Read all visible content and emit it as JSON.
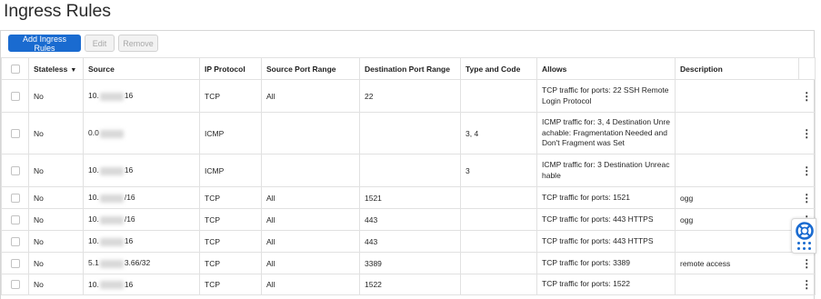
{
  "page": {
    "title": "Ingress Rules"
  },
  "toolbar": {
    "add_label": "Add Ingress Rules",
    "edit_label": "Edit",
    "remove_label": "Remove"
  },
  "table": {
    "headers": {
      "stateless": "Stateless",
      "source": "Source",
      "ip_protocol": "IP Protocol",
      "source_port_range": "Source Port Range",
      "destination_port_range": "Destination Port Range",
      "type_and_code": "Type and Code",
      "allows": "Allows",
      "description": "Description"
    },
    "rows": [
      {
        "stateless": "No",
        "source_prefix": "10.",
        "source_suffix": "16",
        "ip_protocol": "TCP",
        "source_port_range": "All",
        "destination_port_range": "22",
        "type_and_code": "",
        "allows_1": "TCP traffic for ports: 22 SSH Remote",
        "allows_2": "Login Protocol",
        "allows_3": "",
        "description": ""
      },
      {
        "stateless": "No",
        "source_prefix": "0.0",
        "source_suffix": "",
        "ip_protocol": "ICMP",
        "source_port_range": "",
        "destination_port_range": "",
        "type_and_code": "3, 4",
        "allows_1": "ICMP traffic for: 3, 4 Destination Unre",
        "allows_2": "achable: Fragmentation Needed and",
        "allows_3": "Don't Fragment was Set",
        "description": ""
      },
      {
        "stateless": "No",
        "source_prefix": "10.",
        "source_suffix": "16",
        "ip_protocol": "ICMP",
        "source_port_range": "",
        "destination_port_range": "",
        "type_and_code": "3",
        "allows_1": "ICMP traffic for: 3 Destination Unreac",
        "allows_2": "hable",
        "allows_3": "",
        "description": ""
      },
      {
        "stateless": "No",
        "source_prefix": "10.",
        "source_suffix": "/16",
        "ip_protocol": "TCP",
        "source_port_range": "All",
        "destination_port_range": "1521",
        "type_and_code": "",
        "allows_1": "TCP traffic for ports: 1521",
        "allows_2": "",
        "allows_3": "",
        "description": "ogg"
      },
      {
        "stateless": "No",
        "source_prefix": "10.",
        "source_suffix": "/16",
        "ip_protocol": "TCP",
        "source_port_range": "All",
        "destination_port_range": "443",
        "type_and_code": "",
        "allows_1": "TCP traffic for ports: 443 HTTPS",
        "allows_2": "",
        "allows_3": "",
        "description": "ogg"
      },
      {
        "stateless": "No",
        "source_prefix": "10.",
        "source_suffix": "16",
        "ip_protocol": "TCP",
        "source_port_range": "All",
        "destination_port_range": "443",
        "type_and_code": "",
        "allows_1": "TCP traffic for ports: 443 HTTPS",
        "allows_2": "",
        "allows_3": "",
        "description": ""
      },
      {
        "stateless": "No",
        "source_prefix": "5.1",
        "source_suffix": "3.66/32",
        "ip_protocol": "TCP",
        "source_port_range": "All",
        "destination_port_range": "3389",
        "type_and_code": "",
        "allows_1": "TCP traffic for ports: 3389",
        "allows_2": "",
        "allows_3": "",
        "description": "remote access"
      },
      {
        "stateless": "No",
        "source_prefix": "10.",
        "source_suffix": "16",
        "ip_protocol": "TCP",
        "source_port_range": "All",
        "destination_port_range": "1522",
        "type_and_code": "",
        "allows_1": "TCP traffic for ports: 1522",
        "allows_2": "",
        "allows_3": "",
        "description": ""
      }
    ]
  },
  "icons": {
    "kebab": "vertical-ellipsis-icon",
    "sort": "sort-descending-icon",
    "help": "lifebuoy-help-icon",
    "apps": "apps-grid-icon"
  },
  "colors": {
    "primary": "#1a6bd0"
  }
}
